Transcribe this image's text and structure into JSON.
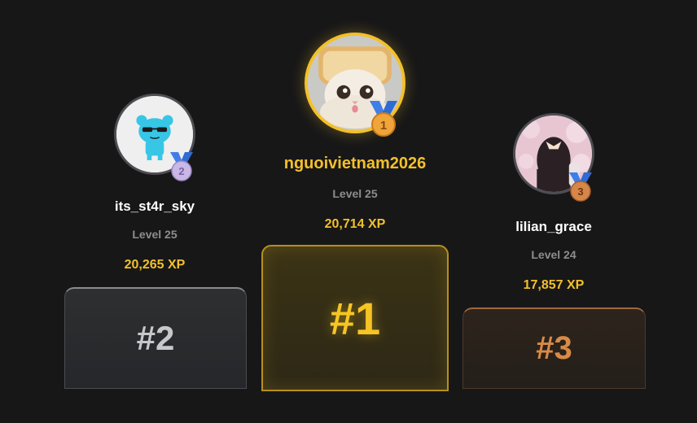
{
  "leaderboard": [
    {
      "rank_label": "#2",
      "medal_number": "2",
      "username": "its_st4r_sky",
      "level": "Level 25",
      "xp": "20,265 XP"
    },
    {
      "rank_label": "#1",
      "medal_number": "1",
      "username": "nguoivietnam2026",
      "level": "Level 25",
      "xp": "20,714 XP"
    },
    {
      "rank_label": "#3",
      "medal_number": "3",
      "username": "lilian_grace",
      "level": "Level 24",
      "xp": "17,857 XP"
    }
  ],
  "colors": {
    "background": "#171718",
    "gold": "#f3c02b",
    "silver": "#c7c8cc",
    "bronze": "#d88a46",
    "medal_ribbon": "#3f7ee8"
  }
}
